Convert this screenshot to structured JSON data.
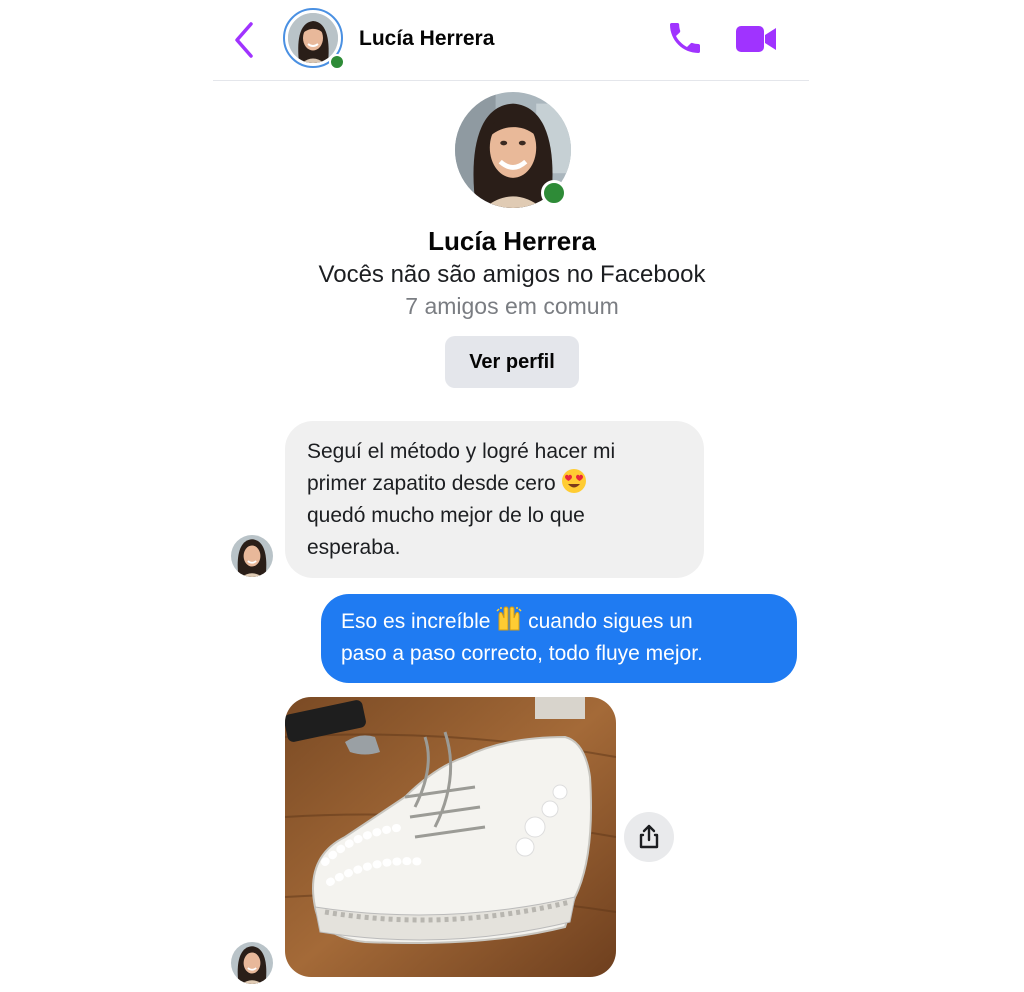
{
  "header": {
    "contact_name": "Lucía Herrera",
    "icons": {
      "back": "chevron-left-icon",
      "call": "phone-icon",
      "video": "video-camera-icon"
    },
    "accent_color": "#a033ff"
  },
  "profile": {
    "name": "Lucía Herrera",
    "relationship": "Vocês não são amigos no Facebook",
    "mutual_friends": "7 amigos em comum",
    "view_profile_label": "Ver perfil",
    "online": true
  },
  "messages": [
    {
      "direction": "incoming",
      "lines": [
        "Seguí el método y logré hacer mi",
        "primer zapatito desde cero",
        "quedó mucho mejor de lo que",
        "esperaba."
      ],
      "emoji": "heart-eyes-emoji"
    },
    {
      "direction": "outgoing",
      "lines": [
        "Eso es increíble",
        "cuando sigues un",
        "paso a paso correcto, todo fluye mejor."
      ],
      "emoji": "raised-hands-emoji"
    },
    {
      "direction": "incoming",
      "type": "image",
      "subject": "white baby sneaker with pearls and flowers"
    }
  ],
  "colors": {
    "outgoing_bubble": "#1f7bf2",
    "incoming_bubble": "#f0f0f0",
    "online": "#2e8b37"
  }
}
